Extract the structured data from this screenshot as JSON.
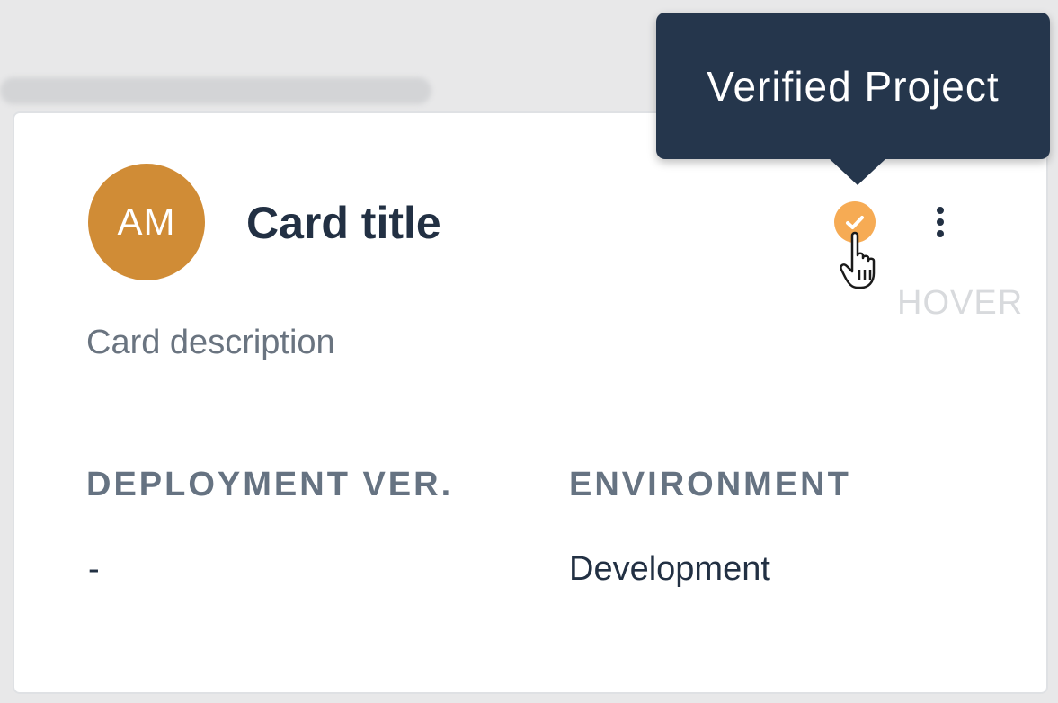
{
  "tooltip": {
    "text": "Verified Project"
  },
  "card": {
    "avatar_initials": "AM",
    "title": "Card title",
    "description": "Card description",
    "verified_icon": "check-circle-icon",
    "more_icon": "more-vertical-icon",
    "state_label": "HOVER",
    "fields": [
      {
        "label": "DEPLOYMENT VER.",
        "value": "-"
      },
      {
        "label": "ENVIRONMENT",
        "value": "Development"
      }
    ]
  },
  "colors": {
    "avatar": "#d08c36",
    "verified_badge": "#f6ab54",
    "tooltip_bg": "#25364c",
    "title_text": "#223043",
    "muted_text": "#6a7480"
  }
}
